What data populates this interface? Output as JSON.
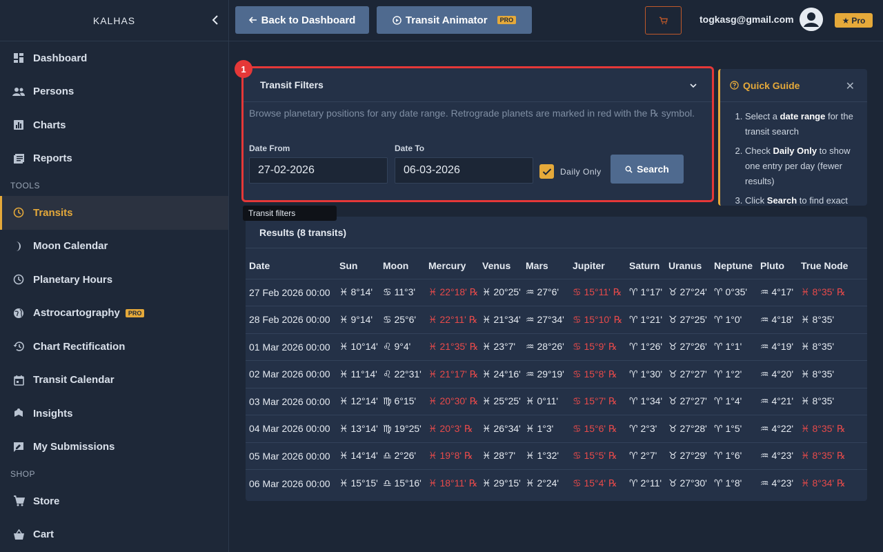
{
  "sidebar": {
    "brand": "KALHAS",
    "items": [
      {
        "label": "Dashboard",
        "icon": "dashboard-icon"
      },
      {
        "label": "Persons",
        "icon": "people-icon"
      },
      {
        "label": "Charts",
        "icon": "bar-chart-icon"
      },
      {
        "label": "Reports",
        "icon": "reports-icon"
      }
    ],
    "tools_label": "TOOLS",
    "tools": [
      {
        "label": "Transits",
        "icon": "clock-icon",
        "active": true
      },
      {
        "label": "Moon Calendar",
        "icon": "moon-icon"
      },
      {
        "label": "Planetary Hours",
        "icon": "clock-icon"
      },
      {
        "label": "Astrocartography",
        "icon": "globe-icon",
        "badge": "PRO"
      },
      {
        "label": "Chart Rectification",
        "icon": "history-icon"
      },
      {
        "label": "Transit Calendar",
        "icon": "calendar-icon"
      },
      {
        "label": "Insights",
        "icon": "insights-icon"
      },
      {
        "label": "My Submissions",
        "icon": "submissions-icon"
      }
    ],
    "shop_label": "SHOP",
    "shop": [
      {
        "label": "Store",
        "icon": "cart-icon"
      },
      {
        "label": "Cart",
        "icon": "basket-icon"
      }
    ]
  },
  "topbar": {
    "back_label": "Back to Dashboard",
    "animator_label": "Transit Animator",
    "animator_badge": "PRO",
    "email": "togkasg@gmail.com",
    "pro_label": "Pro"
  },
  "filters": {
    "step": "1",
    "title": "Transit Filters",
    "description": "Browse planetary positions for any date range. Retrograde planets are marked in red with the ℞ symbol.",
    "date_from_label": "Date From",
    "date_from": "27-02-2026",
    "date_to_label": "Date To",
    "date_to": "06-03-2026",
    "daily_only_label": "Daily Only",
    "search_label": "Search",
    "tooltip": "Transit filters"
  },
  "guide": {
    "title": "Quick Guide",
    "steps": [
      {
        "pre": "Select a ",
        "bold": "date range",
        "post": " for the transit search"
      },
      {
        "pre": "Check ",
        "bold": "Daily Only",
        "post": " to show one entry per day (fewer results)"
      },
      {
        "pre": "Click ",
        "bold": "Search",
        "post": " to find exact"
      }
    ]
  },
  "results": {
    "title": "Results (8 transits)",
    "columns": [
      "Date",
      "Sun",
      "Moon",
      "Mercury",
      "Venus",
      "Mars",
      "Jupiter",
      "Saturn",
      "Uranus",
      "Neptune",
      "Pluto",
      "True Node"
    ],
    "rows": [
      [
        {
          "v": "27 Feb 2026 00:00"
        },
        {
          "v": "♓ 8°14'"
        },
        {
          "v": "♋ 11°3'"
        },
        {
          "v": "♓ 22°18' ℞",
          "r": true
        },
        {
          "v": "♓ 20°25'"
        },
        {
          "v": "♒ 27°6'"
        },
        {
          "v": "♋ 15°11' ℞",
          "r": true
        },
        {
          "v": "♈ 1°17'"
        },
        {
          "v": "♉ 27°24'"
        },
        {
          "v": "♈ 0°35'"
        },
        {
          "v": "♒ 4°17'"
        },
        {
          "v": "♓ 8°35' ℞",
          "r": true
        }
      ],
      [
        {
          "v": "28 Feb 2026 00:00"
        },
        {
          "v": "♓ 9°14'"
        },
        {
          "v": "♋ 25°6'"
        },
        {
          "v": "♓ 22°11' ℞",
          "r": true
        },
        {
          "v": "♓ 21°34'"
        },
        {
          "v": "♒ 27°34'"
        },
        {
          "v": "♋ 15°10' ℞",
          "r": true
        },
        {
          "v": "♈ 1°21'"
        },
        {
          "v": "♉ 27°25'"
        },
        {
          "v": "♈ 1°0'"
        },
        {
          "v": "♒ 4°18'"
        },
        {
          "v": "♓ 8°35'"
        }
      ],
      [
        {
          "v": "01 Mar 2026 00:00"
        },
        {
          "v": "♓ 10°14'"
        },
        {
          "v": "♌ 9°4'"
        },
        {
          "v": "♓ 21°35' ℞",
          "r": true
        },
        {
          "v": "♓ 23°7'"
        },
        {
          "v": "♒ 28°26'"
        },
        {
          "v": "♋ 15°9' ℞",
          "r": true
        },
        {
          "v": "♈ 1°26'"
        },
        {
          "v": "♉ 27°26'"
        },
        {
          "v": "♈ 1°1'"
        },
        {
          "v": "♒ 4°19'"
        },
        {
          "v": "♓ 8°35'"
        }
      ],
      [
        {
          "v": "02 Mar 2026 00:00"
        },
        {
          "v": "♓ 11°14'"
        },
        {
          "v": "♌ 22°31'"
        },
        {
          "v": "♓ 21°17' ℞",
          "r": true
        },
        {
          "v": "♓ 24°16'"
        },
        {
          "v": "♒ 29°19'"
        },
        {
          "v": "♋ 15°8' ℞",
          "r": true
        },
        {
          "v": "♈ 1°30'"
        },
        {
          "v": "♉ 27°27'"
        },
        {
          "v": "♈ 1°2'"
        },
        {
          "v": "♒ 4°20'"
        },
        {
          "v": "♓ 8°35'"
        }
      ],
      [
        {
          "v": "03 Mar 2026 00:00"
        },
        {
          "v": "♓ 12°14'"
        },
        {
          "v": "♍ 6°15'"
        },
        {
          "v": "♓ 20°30' ℞",
          "r": true
        },
        {
          "v": "♓ 25°25'"
        },
        {
          "v": "♓ 0°11'"
        },
        {
          "v": "♋ 15°7' ℞",
          "r": true
        },
        {
          "v": "♈ 1°34'"
        },
        {
          "v": "♉ 27°27'"
        },
        {
          "v": "♈ 1°4'"
        },
        {
          "v": "♒ 4°21'"
        },
        {
          "v": "♓ 8°35'"
        }
      ],
      [
        {
          "v": "04 Mar 2026 00:00"
        },
        {
          "v": "♓ 13°14'"
        },
        {
          "v": "♍ 19°25'"
        },
        {
          "v": "♓ 20°3' ℞",
          "r": true
        },
        {
          "v": "♓ 26°34'"
        },
        {
          "v": "♓ 1°3'"
        },
        {
          "v": "♋ 15°6' ℞",
          "r": true
        },
        {
          "v": "♈ 2°3'"
        },
        {
          "v": "♉ 27°28'"
        },
        {
          "v": "♈ 1°5'"
        },
        {
          "v": "♒ 4°22'"
        },
        {
          "v": "♓ 8°35' ℞",
          "r": true
        }
      ],
      [
        {
          "v": "05 Mar 2026 00:00"
        },
        {
          "v": "♓ 14°14'"
        },
        {
          "v": "♎ 2°26'"
        },
        {
          "v": "♓ 19°8' ℞",
          "r": true
        },
        {
          "v": "♓ 28°7'"
        },
        {
          "v": "♓ 1°32'"
        },
        {
          "v": "♋ 15°5' ℞",
          "r": true
        },
        {
          "v": "♈ 2°7'"
        },
        {
          "v": "♉ 27°29'"
        },
        {
          "v": "♈ 1°6'"
        },
        {
          "v": "♒ 4°23'"
        },
        {
          "v": "♓ 8°35' ℞",
          "r": true
        }
      ],
      [
        {
          "v": "06 Mar 2026 00:00"
        },
        {
          "v": "♓ 15°15'"
        },
        {
          "v": "♎ 15°16'"
        },
        {
          "v": "♓ 18°11' ℞",
          "r": true
        },
        {
          "v": "♓ 29°15'"
        },
        {
          "v": "♓ 2°24'"
        },
        {
          "v": "♋ 15°4' ℞",
          "r": true
        },
        {
          "v": "♈ 2°11'"
        },
        {
          "v": "♉ 27°30'"
        },
        {
          "v": "♈ 1°8'"
        },
        {
          "v": "♒ 4°23'"
        },
        {
          "v": "♓ 8°34' ℞",
          "r": true
        }
      ]
    ]
  },
  "colors": {
    "accent": "#e5a93a",
    "retrograde": "#e84a4a",
    "highlight": "#e53838",
    "primary_button": "#4f6a8f"
  }
}
